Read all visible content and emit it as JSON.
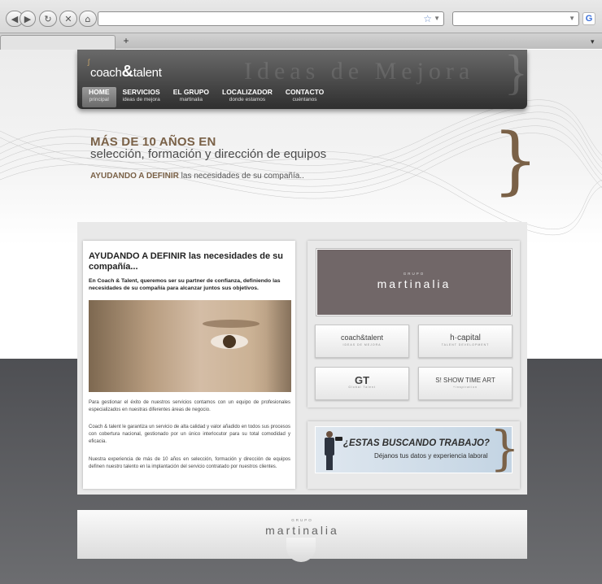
{
  "browser": {
    "back": "◀",
    "forward": "▶",
    "reload": "↻",
    "stop": "✕",
    "home": "⌂",
    "bookmark_star": "☆",
    "new_tab": "+",
    "tab_list": "▾",
    "search_engine": "G"
  },
  "site": {
    "logo_pre": "coach",
    "logo_amp": "&",
    "logo_post": "talent",
    "watermark": "Ideas de Mejora",
    "menu": [
      {
        "label": "HOME",
        "sub": "principal"
      },
      {
        "label": "SERVICIOS",
        "sub": "ideas de mejora"
      },
      {
        "label": "EL GRUPO",
        "sub": "martinalia"
      },
      {
        "label": "LOCALIZADOR",
        "sub": "donde estamos"
      },
      {
        "label": "CONTACTO",
        "sub": "cuéntanos"
      }
    ]
  },
  "hero": {
    "title": "MÁS DE 10 AÑOS EN",
    "subtitle": "selección, formación y dirección de equipos",
    "tag_bold": "AYUDANDO A DEFINIR",
    "tag_rest": " las necesidades de su compañía..",
    "brace": "}"
  },
  "main": {
    "title": "AYUDANDO A DEFINIR las necesidades de su compañía...",
    "intro": "En Coach & Talent, queremos ser su partner de confianza, definiendo las necesidades de su compañía para alcanzar juntos sus objetivos.",
    "paragraphs": [
      "Para gestionar el éxito de nuestros servicios contamos con un equipo de profesionales especializados en nuestras diferentes áreas de negocio.",
      "Coach & talent le garantiza un servicio de alta calidad y valor añadido en todos sus procesos con cobertura nacional, gestionado por un único interlocutor para su total comodidad y eficacia.",
      "Nuestra experiencia de más de 10 años en selección, formación y dirección de equipos definen nuestro talento en la implantación del servicio contratado por nuestros clientes."
    ]
  },
  "group": {
    "top_label": "GRUPO",
    "name": "martinalia",
    "tiles": [
      {
        "name": "coach&talent",
        "sub": "IDEAS DE MEJORA"
      },
      {
        "name": "h·capital",
        "sub": "TALENT DEVELOPMENT"
      },
      {
        "name": "GT",
        "sub": "Global Talent"
      },
      {
        "name": "S! SHOW TIME ART",
        "sub": "+inspiration"
      }
    ]
  },
  "job": {
    "title": "¿ESTAS BUSCANDO TRABAJO?",
    "subtitle": "Déjanos tus datos y experiencia laboral",
    "brace": "}"
  },
  "footer": {
    "top_label": "GRUPO",
    "name": "martinalia"
  }
}
